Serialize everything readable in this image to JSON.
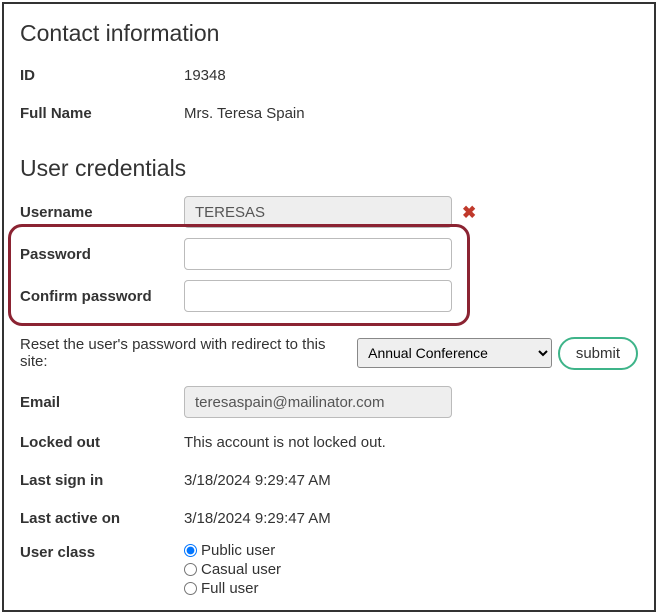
{
  "contact": {
    "heading": "Contact information",
    "id_label": "ID",
    "id_value": "19348",
    "fullname_label": "Full Name",
    "fullname_value": "Mrs. Teresa Spain"
  },
  "credentials": {
    "heading": "User credentials",
    "username_label": "Username",
    "username_value": "TERESAS",
    "password_label": "Password",
    "password_value": "",
    "confirm_label": "Confirm password",
    "confirm_value": "",
    "reset_text": "Reset the user's password with redirect to this site:",
    "reset_site_selected": "Annual Conference",
    "submit_label": "submit",
    "email_label": "Email",
    "email_value": "teresaspain@mailinator.com",
    "locked_label": "Locked out",
    "locked_value": "This account is not locked out.",
    "lastsignin_label": "Last sign in",
    "lastsignin_value": "3/18/2024 9:29:47 AM",
    "lastactive_label": "Last active on",
    "lastactive_value": "3/18/2024 9:29:47 AM",
    "userclass_label": "User class",
    "userclass_options": {
      "public": "Public user",
      "casual": "Casual user",
      "full": "Full user"
    },
    "userclass_selected": "public"
  }
}
